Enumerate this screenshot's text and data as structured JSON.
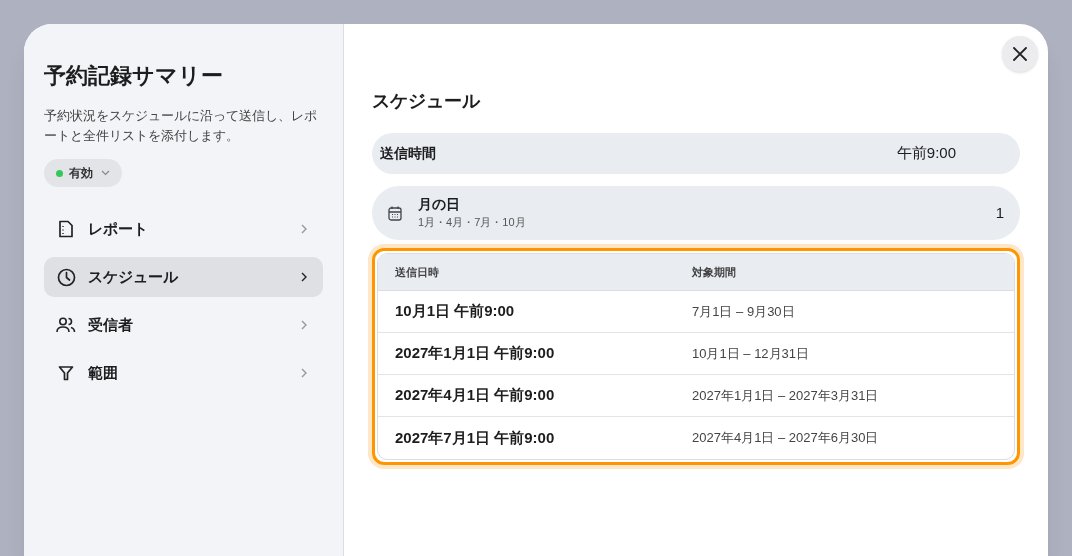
{
  "sidebar": {
    "title": "予約記録サマリー",
    "description": "予約状況をスケジュールに沿って送信し、レポートと全件リストを添付します。",
    "status": {
      "label": "有効",
      "color": "#34c759"
    },
    "items": [
      {
        "label": "レポート",
        "kind": "report",
        "selected": false
      },
      {
        "label": "スケジュール",
        "kind": "schedule",
        "selected": true
      },
      {
        "label": "受信者",
        "kind": "recipients",
        "selected": false
      },
      {
        "label": "範囲",
        "kind": "scope",
        "selected": false
      }
    ]
  },
  "main": {
    "title": "スケジュール",
    "send_time": {
      "label": "送信時間",
      "value": "午前9:00"
    },
    "day_of_month": {
      "label": "月の日",
      "months": "1月・4月・7月・10月",
      "value": "1"
    },
    "table": {
      "highlighted": true,
      "columns": [
        "送信日時",
        "対象期間"
      ],
      "rows": [
        [
          "10月1日 午前9:00",
          "7月1日 – 9月30日"
        ],
        [
          "2027年1月1日 午前9:00",
          "10月1日 – 12月31日"
        ],
        [
          "2027年4月1日 午前9:00",
          "2027年1月1日 – 2027年3月31日"
        ],
        [
          "2027年7月1日 午前9:00",
          "2027年4月1日 – 2027年6月30日"
        ]
      ]
    }
  }
}
